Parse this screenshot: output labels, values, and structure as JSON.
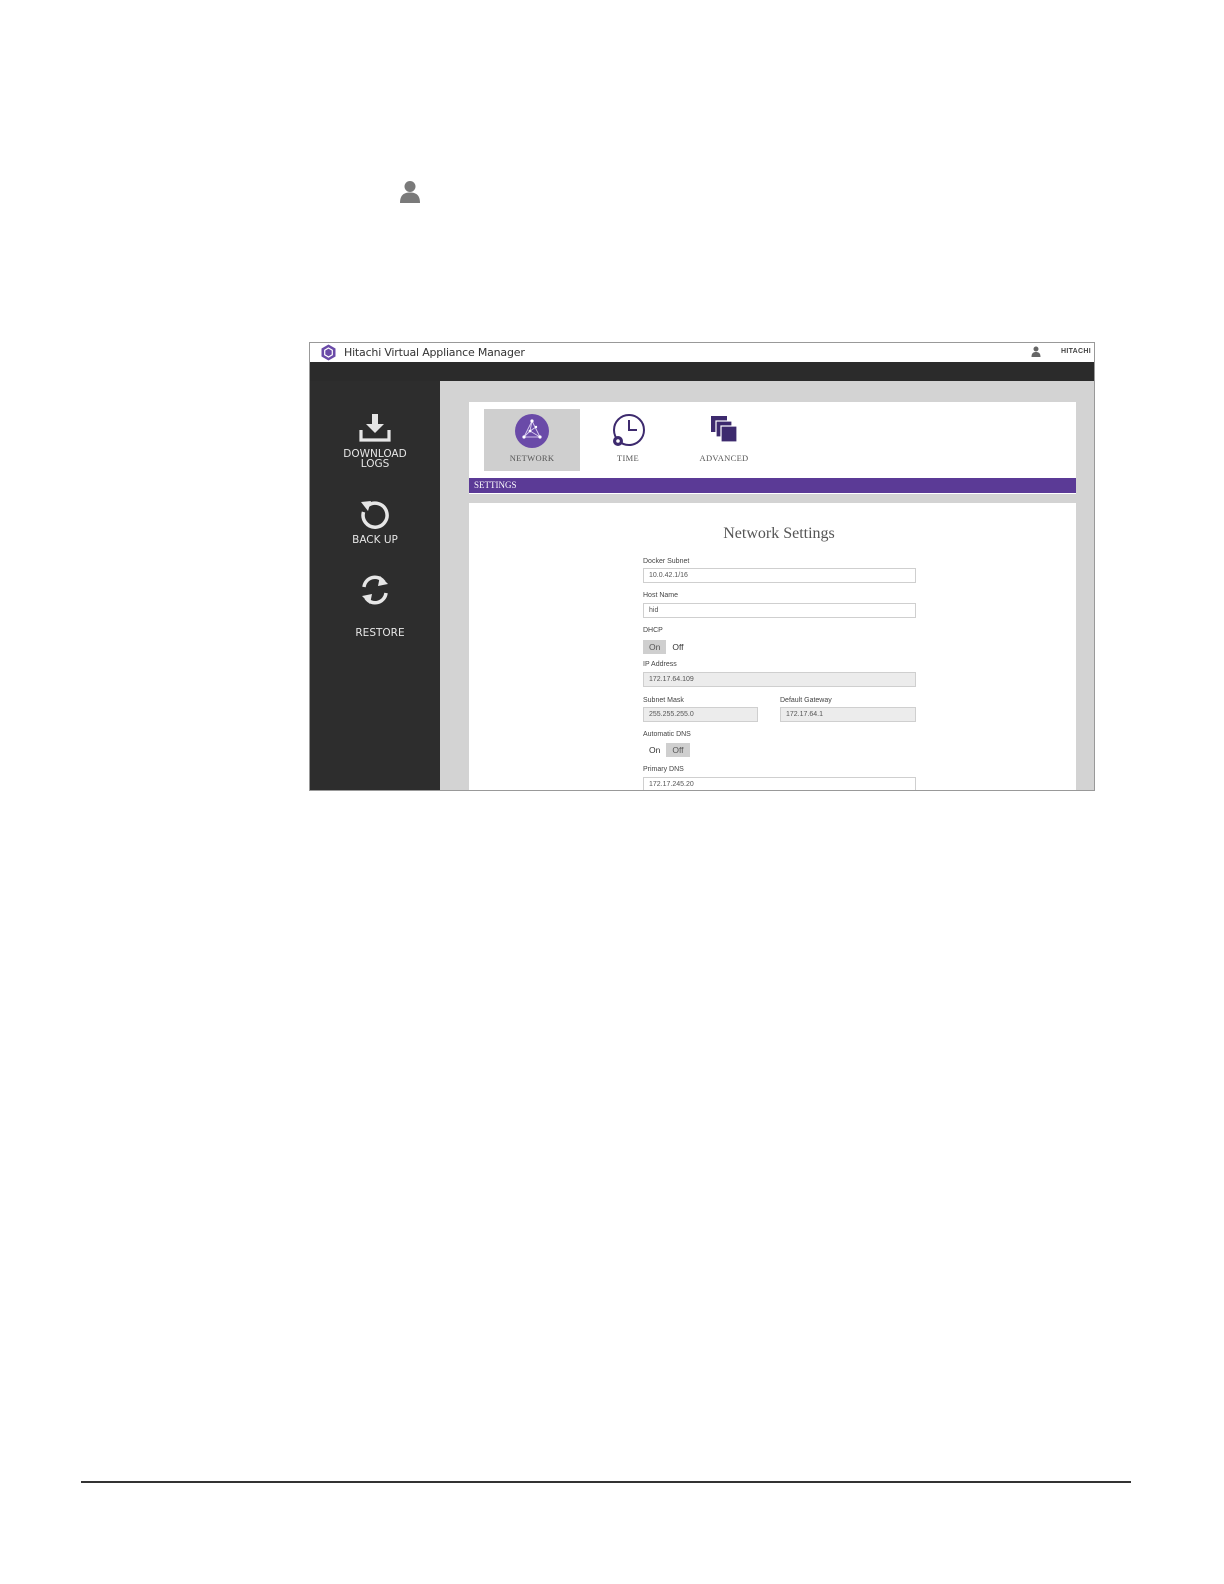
{
  "app": {
    "title": "Hitachi Virtual Appliance Manager",
    "brand": "HITACHI"
  },
  "sidebar": {
    "items": [
      {
        "label_line1": "DOWNLOAD",
        "label_line2": "LOGS",
        "icon": "download-icon"
      },
      {
        "label_line1": "BACK UP",
        "icon": "backup-icon"
      },
      {
        "label_line1": "RESTORE",
        "icon": "restore-icon"
      }
    ]
  },
  "tabs": [
    {
      "label": "NETWORK",
      "icon": "network-icon",
      "active": true
    },
    {
      "label": "TIME",
      "icon": "clock-icon",
      "active": false
    },
    {
      "label": "ADVANCED",
      "icon": "advanced-icon",
      "active": false
    }
  ],
  "settings_bar": "SETTINGS",
  "form": {
    "title": "Network Settings",
    "docker_subnet": {
      "label": "Docker Subnet",
      "value": "10.0.42.1/16"
    },
    "host_name": {
      "label": "Host Name",
      "value": "hid"
    },
    "dhcp": {
      "label": "DHCP",
      "on": "On",
      "off": "Off",
      "selected": "On"
    },
    "ip_address": {
      "label": "IP Address",
      "value": "172.17.64.109"
    },
    "subnet_mask": {
      "label": "Subnet Mask",
      "value": "255.255.255.0"
    },
    "default_gateway": {
      "label": "Default Gateway",
      "value": "172.17.64.1"
    },
    "automatic_dns": {
      "label": "Automatic DNS",
      "on": "On",
      "off": "Off",
      "selected": "Off"
    },
    "primary_dns": {
      "label": "Primary DNS",
      "value": "172.17.245.20"
    }
  },
  "colors": {
    "accent": "#5b3a96",
    "sidebar_bg": "#2d2d2d",
    "content_bg": "#d3d3d3"
  }
}
